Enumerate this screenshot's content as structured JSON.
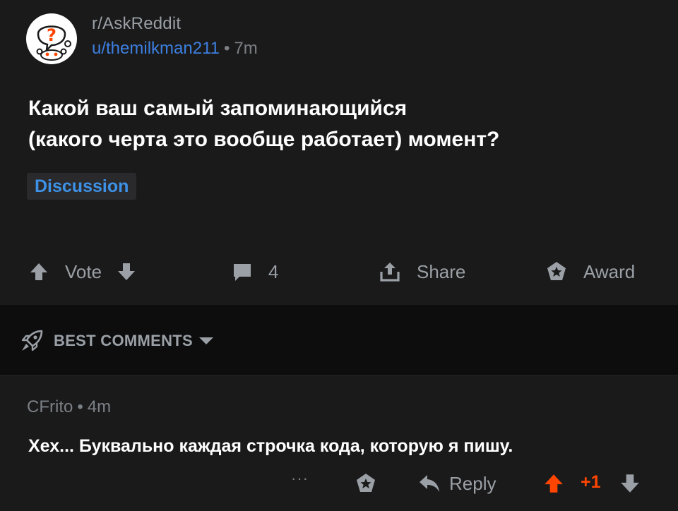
{
  "post": {
    "subreddit": "r/AskReddit",
    "author": "u/themilkman211",
    "separator": "•",
    "age": "7m",
    "title_lines": [
      "Какой ваш самый запоминающийся",
      "(какого черта это вообще работает) момент?"
    ],
    "flair": "Discussion",
    "actions": {
      "vote_label": "Vote",
      "comment_count": "4",
      "share_label": "Share",
      "award_label": "Award"
    }
  },
  "sort": {
    "label": "BEST COMMENTS",
    "icon": "rocket-icon"
  },
  "comment": {
    "author": "CFrito",
    "separator": "•",
    "age": "4m",
    "body": "Хех... Буквально каждая строчка кода, которую я пишу.",
    "more_label": "···",
    "reply_label": "Reply",
    "score": "+1"
  },
  "colors": {
    "background": "#1a1a1b",
    "sort_bar": "#0d0d0e",
    "author_link": "#3d7fe0",
    "flair_text": "#3d91e6",
    "upvoted": "#ff4500",
    "muted": "#9aa0a5"
  }
}
